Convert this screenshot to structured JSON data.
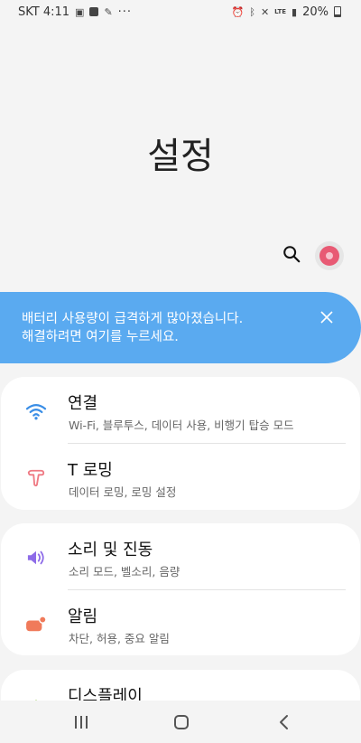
{
  "status_bar": {
    "carrier_time": "SKT 4:11",
    "overflow": "···",
    "network": "LTE",
    "battery": "20%"
  },
  "page": {
    "title": "설정"
  },
  "toolbar": {
    "search_icon": "search-icon",
    "avatar_icon": "profile-avatar"
  },
  "alert": {
    "line1": "배터리 사용량이 급격하게 많아졌습니다.",
    "line2": "해결하려면 여기를 누르세요.",
    "close_icon": "close-icon",
    "color": "#5aaaf0"
  },
  "settings": [
    {
      "title": "연결",
      "subtitle": "Wi-Fi, 블루투스, 데이터 사용, 비행기 탑승 모드",
      "icon": "wifi-icon",
      "color": "#3a8ee6"
    },
    {
      "title": "T 로밍",
      "subtitle": "데이터 로밍, 로밍 설정",
      "icon": "t-roaming-icon",
      "color": "#ef7a84"
    },
    {
      "title": "소리 및 진동",
      "subtitle": "소리 모드, 벨소리, 음량",
      "icon": "speaker-icon",
      "color": "#8e6ce8"
    },
    {
      "title": "알림",
      "subtitle": "차단, 허용, 중요 알림",
      "icon": "notification-icon",
      "color": "#f07a5a"
    },
    {
      "title": "디스플레이",
      "subtitle": "",
      "icon": "display-icon",
      "color": "#8bc53f"
    }
  ],
  "nav": {
    "recent_icon": "recent-apps-icon",
    "home_icon": "home-icon",
    "back_icon": "back-icon"
  }
}
